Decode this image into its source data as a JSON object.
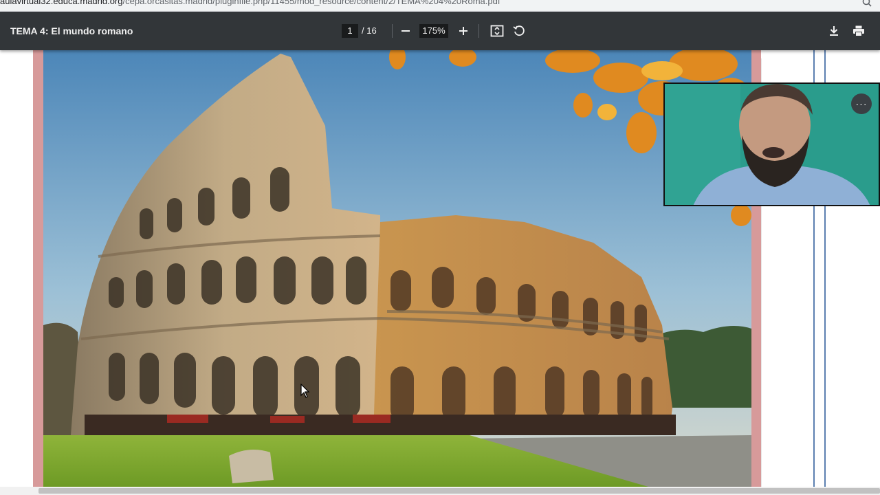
{
  "browser": {
    "url_prefix": "aulavirtual32.educa.madrid.org",
    "url_rest": "/cepa.orcasitas.madrid/pluginfile.php/11455/mod_resource/content/2/TEMA%204%20Roma.pdf"
  },
  "toolbar": {
    "title": "TEMA 4: El mundo romano",
    "page_current": "1",
    "page_total": "/ 16",
    "zoom": "175%"
  },
  "video": {
    "more_label": "···"
  },
  "colors": {
    "toolbar_bg": "#323639",
    "page_border": "#d79a9a",
    "video_bg": "#2aa090"
  },
  "icons": {
    "zoom_out": "minus-icon",
    "zoom_in": "plus-icon",
    "fit": "fit-page-icon",
    "rotate": "rotate-icon",
    "download": "download-icon",
    "print": "print-icon"
  }
}
